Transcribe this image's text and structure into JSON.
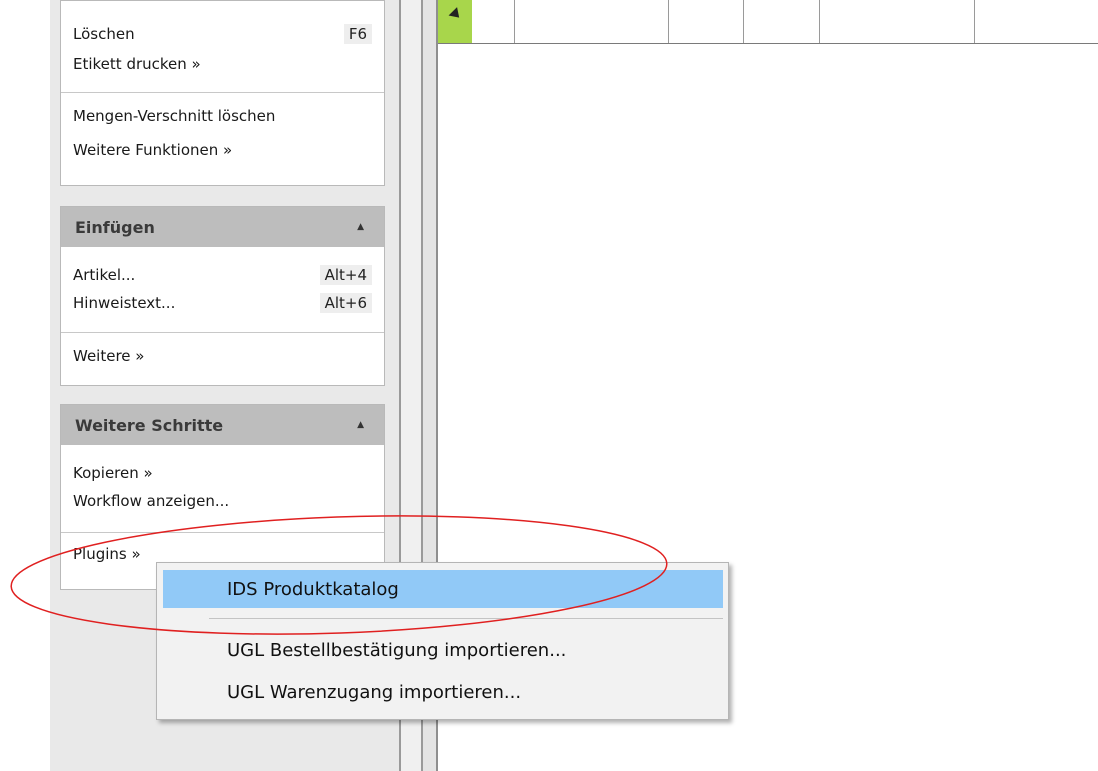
{
  "sidebar": {
    "actions": {
      "group1": [
        {
          "label": "Löschen",
          "shortcut": "F6"
        },
        {
          "label": "Etikett drucken »"
        }
      ],
      "group2": [
        {
          "label": "Mengen-Verschnitt löschen"
        },
        {
          "label": "Weitere Funktionen »"
        }
      ]
    },
    "einfuegen": {
      "title": "Einfügen",
      "items": [
        {
          "label": "Artikel...",
          "shortcut": "Alt+4"
        },
        {
          "label": "Hinweistext...",
          "shortcut": "Alt+6"
        }
      ],
      "more": "Weitere »"
    },
    "weitere_schritte": {
      "title": "Weitere Schritte",
      "items": [
        {
          "label": "Kopieren »"
        },
        {
          "label": "Workflow anzeigen..."
        }
      ],
      "plugins": "Plugins »"
    }
  },
  "icons": {
    "collapse": "chevron-up-icon",
    "corner": "grid-corner-icon"
  },
  "colors": {
    "highlight": "#91c9f7",
    "grid_corner": "#a8d64b",
    "annotation": "#e02020"
  },
  "context_menu": {
    "items": [
      {
        "label": "IDS Produktkatalog",
        "highlighted": true
      },
      {
        "label": "UGL Bestellbestätigung importieren..."
      },
      {
        "label": "UGL Warenzugang importieren..."
      }
    ]
  }
}
